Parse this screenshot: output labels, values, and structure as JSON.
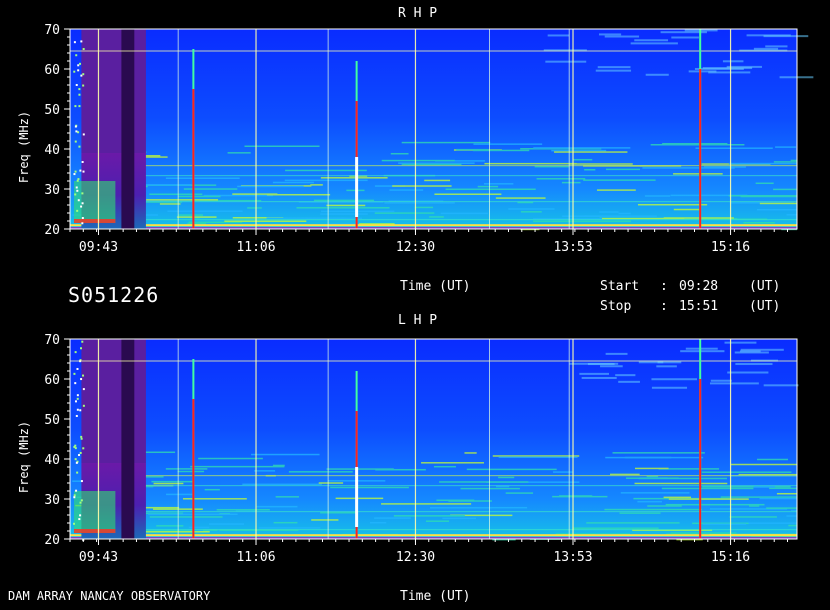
{
  "header": {
    "session_id": "S051226",
    "time_label": "Time (UT)",
    "start_label": "Start",
    "start_value": "09:28",
    "stop_label": "Stop",
    "stop_value": "15:51",
    "colon": ":",
    "ut_unit": "(UT)"
  },
  "footer": {
    "observatory": "DAM ARRAY  NANCAY OBSERVATORY",
    "time_label": "Time (UT)"
  },
  "colors": {
    "background": "#000000",
    "spectrum_low": "#0a2cff",
    "spectrum_mid": "#1fa6ff",
    "spectrum_high": "#ffff00",
    "burst": "#ff2020",
    "grid": "#ffffaa",
    "attenuated_band": "#5a1fa0"
  },
  "chart_data": [
    {
      "type": "heatmap",
      "title": "R H P",
      "ylabel": "Freq (MHz)",
      "xlabel": "Time (UT)",
      "xlim": [
        "09:28",
        "15:51"
      ],
      "ylim": [
        20,
        70
      ],
      "x_ticks": [
        "09:43",
        "11:06",
        "12:30",
        "13:53",
        "15:16"
      ],
      "y_ticks": [
        20,
        30,
        40,
        50,
        60,
        70
      ],
      "bursts_utc": [
        "10:33",
        "11:59",
        "15:00"
      ],
      "attenuated_interval_utc": [
        "09:34",
        "10:08"
      ]
    },
    {
      "type": "heatmap",
      "title": "L H P",
      "ylabel": "Freq (MHz)",
      "xlabel": "Time (UT)",
      "xlim": [
        "09:28",
        "15:51"
      ],
      "ylim": [
        20,
        70
      ],
      "x_ticks": [
        "09:43",
        "11:06",
        "12:30",
        "13:53",
        "15:16"
      ],
      "y_ticks": [
        20,
        30,
        40,
        50,
        60,
        70
      ],
      "bursts_utc": [
        "10:33",
        "11:59",
        "15:00"
      ],
      "attenuated_interval_utc": [
        "09:34",
        "10:08"
      ]
    }
  ]
}
